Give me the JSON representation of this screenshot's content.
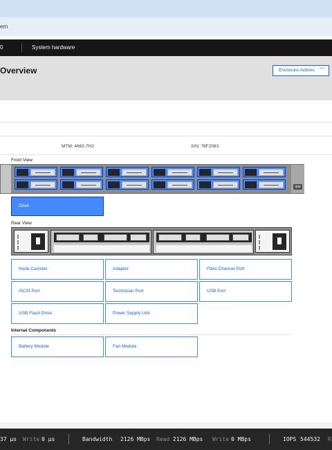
{
  "breadcrumb": {
    "text": "em"
  },
  "nav": {
    "left_truncated": "0",
    "title": "System hardware"
  },
  "header": {
    "title": "Overview",
    "actions_button": "Enclosure Actions"
  },
  "enclosure": {
    "mtm": "MTM: 4662-7H2",
    "sn": "S/N: 78F2083"
  },
  "front_view": {
    "label": "Front View",
    "logo": "IBM",
    "drive_button": "Drive"
  },
  "rear_view": {
    "label": "Rear View",
    "tiles": [
      "Node Canister",
      "Adapter",
      "Fibre Channel Port",
      "iSCSI Port",
      "Technician Port",
      "USB Port",
      "USB Flash Drive",
      "Power Supply Unit"
    ]
  },
  "internal": {
    "label": "Internal Components",
    "tiles": [
      "Battery Module",
      "Fan Module"
    ]
  },
  "status": {
    "latency_value": "37 µs",
    "write_latency_label": "Write",
    "write_latency_value": "0 µs",
    "bandwidth_label": "Bandwidth",
    "bandwidth_value": "2126 MBps",
    "read_label": "Read",
    "read_value": "2126 MBps",
    "write_bw_label": "Write",
    "write_bw_value": "0 MBps",
    "iops_label": "IOPS",
    "iops_value": "544532",
    "trailing": "R"
  }
}
